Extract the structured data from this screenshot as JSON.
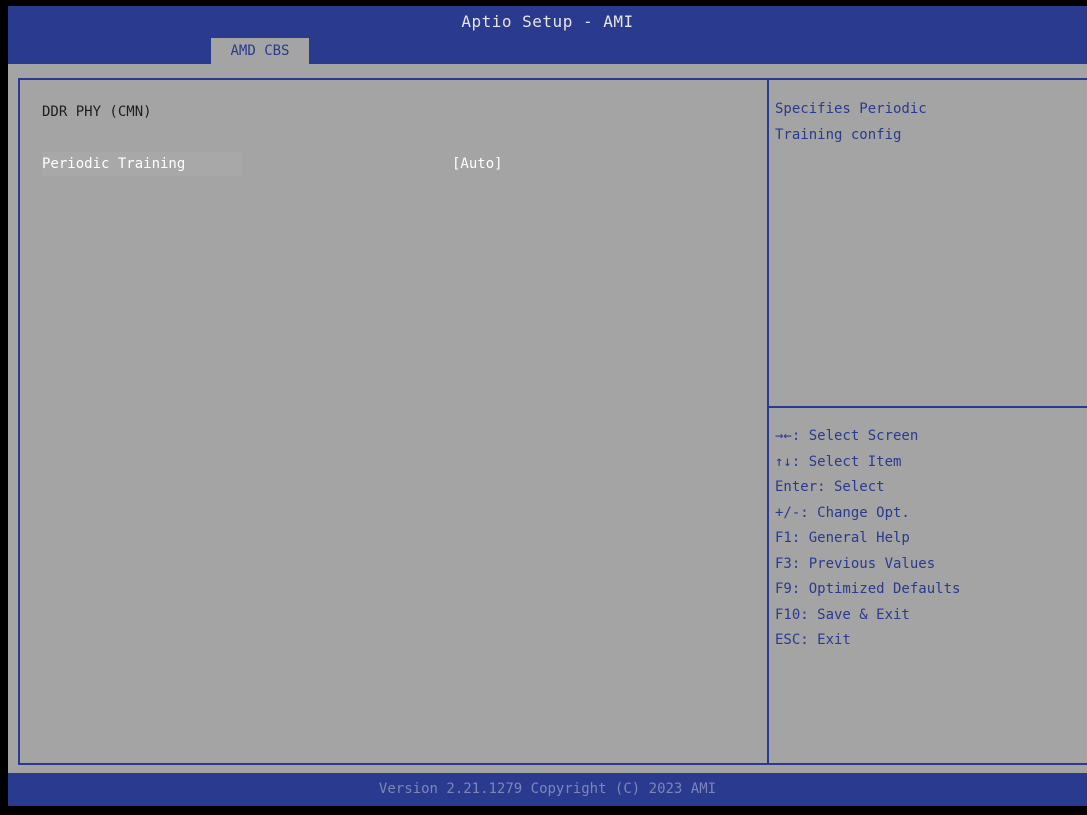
{
  "window": {
    "title": "Aptio Setup - AMI"
  },
  "tabs": [
    {
      "label": "AMD CBS",
      "active": true
    }
  ],
  "main": {
    "section_title": "DDR PHY (CMN)",
    "settings": [
      {
        "label": "Periodic Training",
        "value": "[Auto]"
      }
    ]
  },
  "help": {
    "lines": [
      "Specifies Periodic",
      "Training config"
    ]
  },
  "keys": [
    "→←: Select Screen",
    "↑↓: Select Item",
    "Enter: Select",
    "+/-: Change Opt.",
    "F1: General Help",
    "F3: Previous Values",
    "F9: Optimized Defaults",
    "F10: Save & Exit",
    "ESC: Exit"
  ],
  "footer": {
    "text": "Version 2.21.1279 Copyright (C) 2023 AMI"
  },
  "colors": {
    "header_blue": "#2a3a8e",
    "panel_gray": "#a4a4a4",
    "selected_text": "#ffffff",
    "help_text": "#2a3a8e"
  }
}
